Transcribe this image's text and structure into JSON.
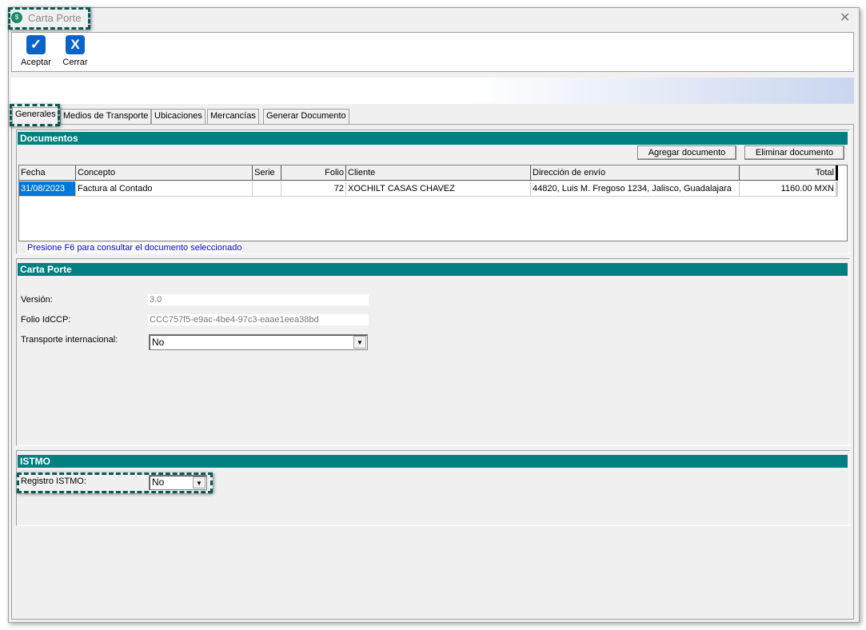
{
  "window": {
    "title": "Carta Porte",
    "close": "✕"
  },
  "toolbar": {
    "accept": "Aceptar",
    "close": "Cerrar",
    "accept_icon": "✓",
    "close_icon": "X"
  },
  "tabs": [
    "Generales",
    "Medios de Transporte",
    "Ubicaciones",
    "Mercancías",
    "Generar Documento"
  ],
  "documentos": {
    "title": "Documentos",
    "add": "Agregar documento",
    "remove": "Eliminar documento",
    "columns": [
      "Fecha",
      "Concepto",
      "Serie",
      "Folio",
      "Cliente",
      "Dirección de envío",
      "Total"
    ],
    "rows": [
      [
        "31/08/2023",
        "Factura al Contado",
        "",
        "72",
        "XOCHILT CASAS CHAVEZ",
        "44820, Luis M. Fregoso 1234, Jalisco, Guadalajara",
        "1160.00 MXN"
      ]
    ],
    "hint": "Presione F6 para consultar el documento seleccionado"
  },
  "carta": {
    "title": "Carta Porte",
    "version_label": "Versión:",
    "version": "3.0",
    "folio_label": "Folio IdCCP:",
    "folio": "CCC757f5-e9ac-4be4-97c3-eaae1eea38bd",
    "transporte_label": "Transporte internacional:",
    "transporte": "No"
  },
  "istmo": {
    "title": "ISTMO",
    "registro_label": "Registro ISTMO:",
    "registro": "No"
  }
}
